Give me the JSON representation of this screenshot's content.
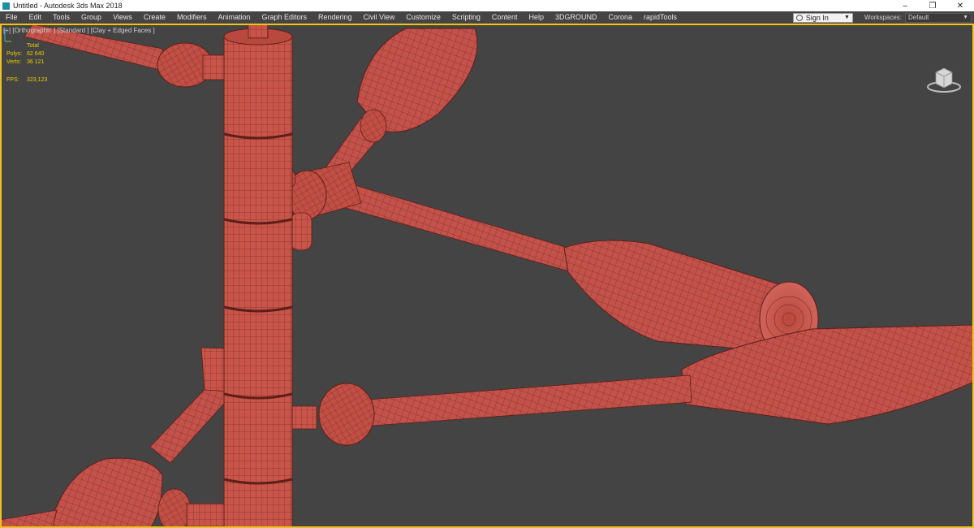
{
  "window": {
    "title": "Untitled - Autodesk 3ds Max 2018",
    "controls": [
      "–",
      "❐",
      "✕"
    ]
  },
  "menu": {
    "items": [
      "File",
      "Edit",
      "Tools",
      "Group",
      "Views",
      "Create",
      "Modifiers",
      "Animation",
      "Graph Editors",
      "Rendering",
      "Civil View",
      "Customize",
      "Scripting",
      "Content",
      "Help",
      "3DGROUND",
      "Corona",
      "rapidTools"
    ],
    "signin_label": "Sign In",
    "workspaces_label": "Workspaces:",
    "workspace_value": "Default"
  },
  "viewport": {
    "label": "[+] [Orthographic ] [Standard ] [Clay + Edged Faces ]",
    "stats": {
      "header": "Total",
      "polys_label": "Polys:",
      "polys_value": "62 640",
      "verts_label": "Verts:",
      "verts_value": "36 121",
      "fps_label": "FPS:",
      "fps_value": "323,123"
    }
  },
  "colors": {
    "accent": "#f0c21c",
    "clay": "#c9554a",
    "stats_text": "#e8d000"
  }
}
